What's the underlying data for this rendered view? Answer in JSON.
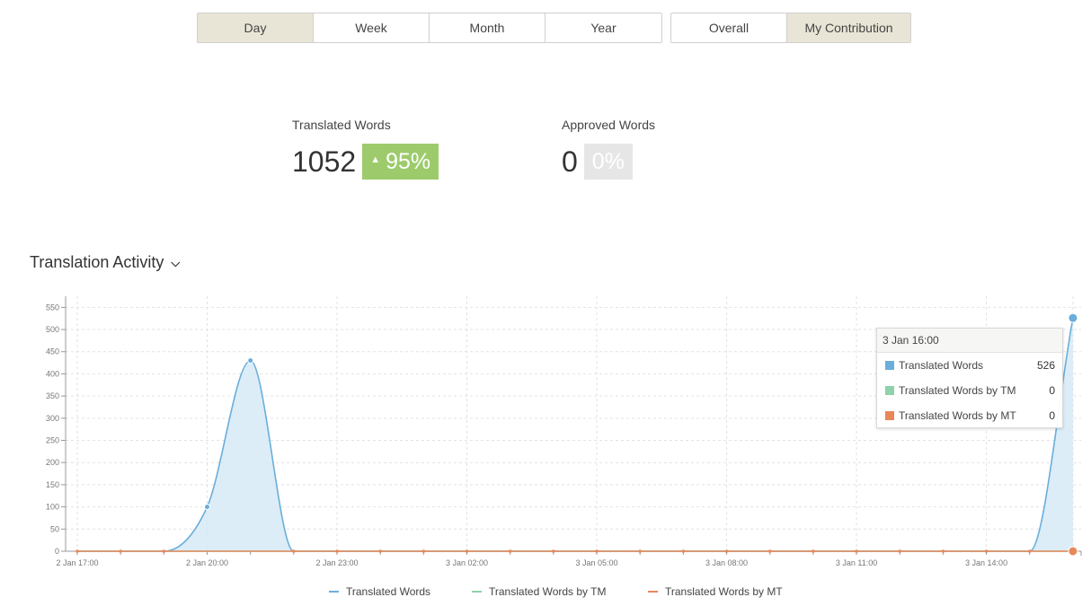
{
  "period_tabs": [
    {
      "label": "Day",
      "active": true
    },
    {
      "label": "Week",
      "active": false
    },
    {
      "label": "Month",
      "active": false
    },
    {
      "label": "Year",
      "active": false
    }
  ],
  "scope_tabs": [
    {
      "label": "Overall",
      "active": false
    },
    {
      "label": "My Contribution",
      "active": true
    }
  ],
  "stats": {
    "translated": {
      "label": "Translated Words",
      "value": "1052",
      "change": "95%"
    },
    "approved": {
      "label": "Approved Words",
      "value": "0",
      "change": "0%"
    }
  },
  "section": {
    "title": "Translation Activity"
  },
  "colors": {
    "translated": "#6aaedb",
    "tm": "#8fd1ab",
    "mt": "#e8875a",
    "area": "#d6eaf7"
  },
  "tooltip": {
    "time": "3 Jan 16:00",
    "rows": [
      {
        "label": "Translated Words",
        "value": "526"
      },
      {
        "label": "Translated Words by TM",
        "value": "0"
      },
      {
        "label": "Translated Words by MT",
        "value": "0"
      }
    ]
  },
  "chart_data": {
    "type": "area",
    "x_tick_labels": [
      "2 Jan 17:00",
      "2 Jan 20:00",
      "2 Jan 23:00",
      "3 Jan 02:00",
      "3 Jan 05:00",
      "3 Jan 08:00",
      "3 Jan 11:00",
      "3 Jan 14:00"
    ],
    "x": [
      "2 Jan 17:00",
      "2 Jan 18:00",
      "2 Jan 19:00",
      "2 Jan 20:00",
      "2 Jan 21:00",
      "2 Jan 22:00",
      "2 Jan 23:00",
      "3 Jan 00:00",
      "3 Jan 01:00",
      "3 Jan 02:00",
      "3 Jan 03:00",
      "3 Jan 04:00",
      "3 Jan 05:00",
      "3 Jan 06:00",
      "3 Jan 07:00",
      "3 Jan 08:00",
      "3 Jan 09:00",
      "3 Jan 10:00",
      "3 Jan 11:00",
      "3 Jan 12:00",
      "3 Jan 13:00",
      "3 Jan 14:00",
      "3 Jan 15:00",
      "3 Jan 16:00"
    ],
    "series": [
      {
        "name": "Translated Words",
        "values": [
          0,
          0,
          0,
          100,
          430,
          0,
          0,
          0,
          0,
          0,
          0,
          0,
          0,
          0,
          0,
          0,
          0,
          0,
          0,
          0,
          0,
          0,
          0,
          526
        ]
      },
      {
        "name": "Translated Words by TM",
        "values": [
          0,
          0,
          0,
          0,
          0,
          0,
          0,
          0,
          0,
          0,
          0,
          0,
          0,
          0,
          0,
          0,
          0,
          0,
          0,
          0,
          0,
          0,
          0,
          0
        ]
      },
      {
        "name": "Translated Words by MT",
        "values": [
          0,
          0,
          0,
          0,
          0,
          0,
          0,
          0,
          0,
          0,
          0,
          0,
          0,
          0,
          0,
          0,
          0,
          0,
          0,
          0,
          0,
          0,
          0,
          0
        ]
      }
    ],
    "y_ticks": [
      0,
      50,
      100,
      150,
      200,
      250,
      300,
      350,
      400,
      450,
      500,
      550
    ],
    "ylim": [
      0,
      575
    ],
    "grid": true,
    "legend": "bottom-center"
  }
}
